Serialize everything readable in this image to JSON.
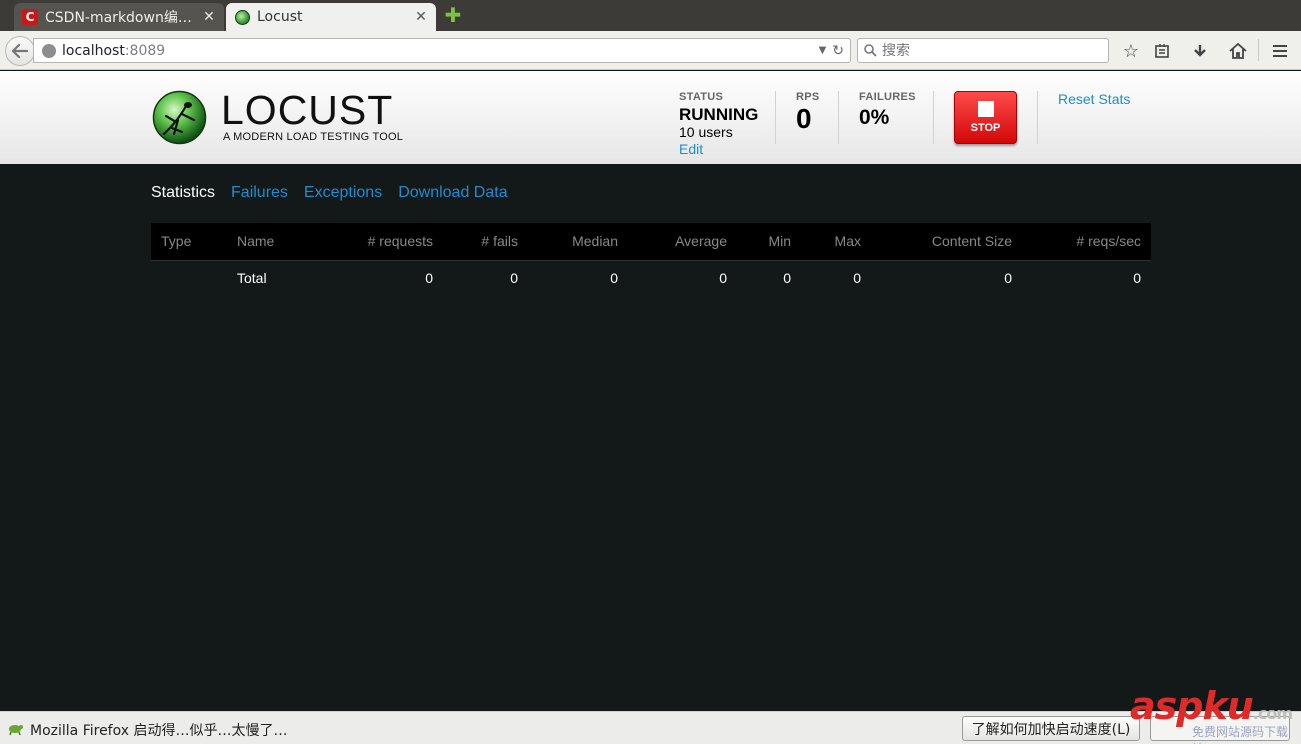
{
  "browser": {
    "tabs": [
      {
        "title": "CSDN-markdown编…",
        "favicon": "csdn-logo-icon",
        "favicon_text": "C",
        "active": false
      },
      {
        "title": "Locust",
        "favicon": "locust-favicon-icon",
        "active": true
      }
    ],
    "url": {
      "host": "localhost",
      "port": ":8089"
    },
    "search": {
      "placeholder": "搜索"
    },
    "statusbar": {
      "message": "Mozilla Firefox 启动得…似乎…太慢了…",
      "button_label": "了解如何加快启动速度(L)"
    }
  },
  "header": {
    "logo_text": "LOCUST",
    "tagline": "A MODERN LOAD TESTING TOOL",
    "status": {
      "label": "STATUS",
      "value": "RUNNING",
      "users": "10 users",
      "edit_label": "Edit"
    },
    "rps": {
      "label": "RPS",
      "value": "0"
    },
    "failures": {
      "label": "FAILURES",
      "value": "0%"
    },
    "stop": {
      "label": "STOP"
    },
    "reset_label": "Reset Stats"
  },
  "main": {
    "tabs": [
      {
        "label": "Statistics",
        "current": true
      },
      {
        "label": "Failures",
        "current": false
      },
      {
        "label": "Exceptions",
        "current": false
      },
      {
        "label": "Download Data",
        "current": false
      }
    ],
    "table": {
      "headers": [
        "Type",
        "Name",
        "# requests",
        "# fails",
        "Median",
        "Average",
        "Min",
        "Max",
        "Content Size",
        "# reqs/sec"
      ],
      "rows": [
        [
          "",
          "Total",
          "0",
          "0",
          "0",
          "0",
          "0",
          "0",
          "0",
          "0"
        ]
      ]
    }
  },
  "watermark": {
    "brand": "aspku",
    "suffix": ".com",
    "sub": "免费网站源码下载站!"
  },
  "colors": {
    "link": "#1d8dd1",
    "stop": "#e01010",
    "page_bg": "#131919"
  }
}
